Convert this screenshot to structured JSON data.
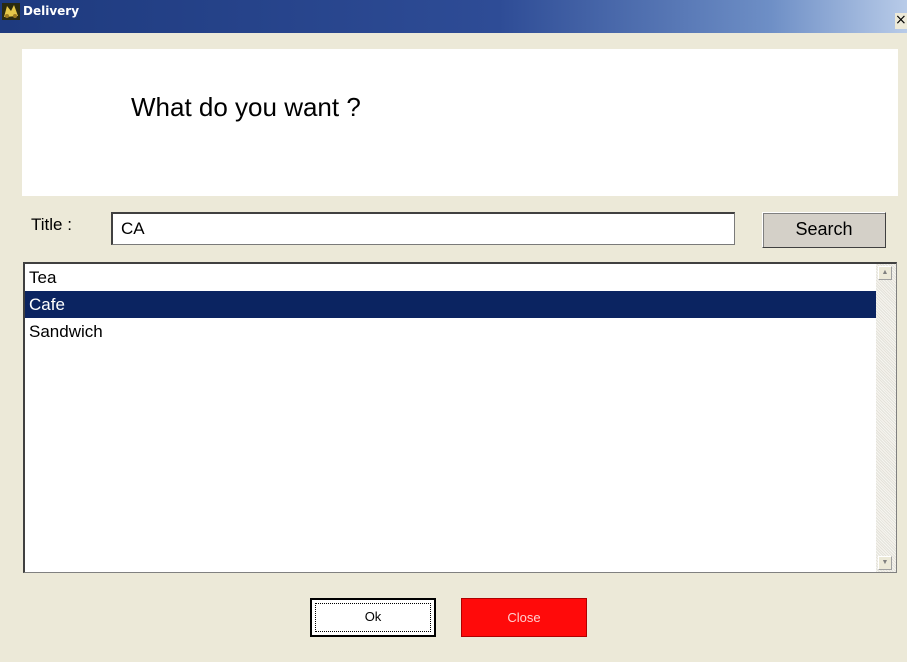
{
  "window": {
    "title": "Delivery",
    "close_symbol": "×",
    "app_icon": "delivery-app-icon"
  },
  "prompt": {
    "text": "What do you want ?"
  },
  "search": {
    "label": "Title :",
    "value": "CA",
    "button_label": "Search"
  },
  "list": {
    "items": [
      {
        "label": "Tea",
        "selected": false
      },
      {
        "label": "Cafe",
        "selected": true
      },
      {
        "label": "Sandwich",
        "selected": false
      }
    ],
    "scroll_up_icon": "▲",
    "scroll_down_icon": "▼"
  },
  "buttons": {
    "ok_label": "Ok",
    "close_label": "Close"
  },
  "colors": {
    "selection": "#0B2461",
    "close_button": "#FF0A0A",
    "dialog_background": "#ECE9D8"
  }
}
